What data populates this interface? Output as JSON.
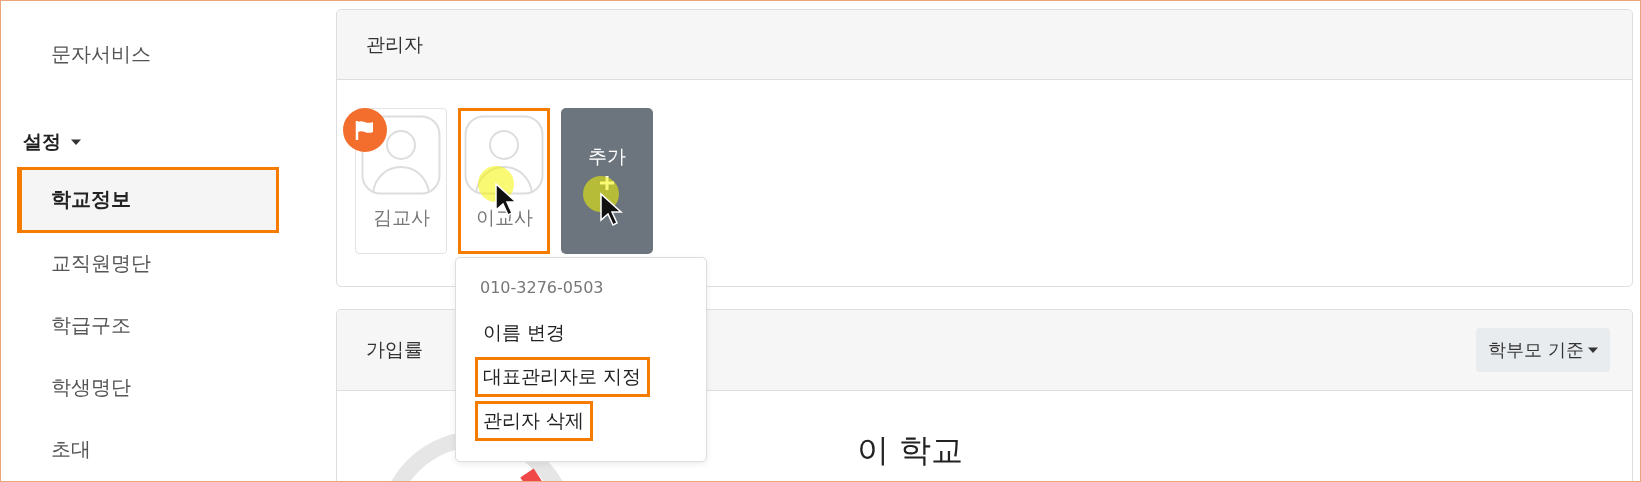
{
  "sidebar": {
    "items": [
      {
        "label": "문자서비스",
        "selected": false,
        "highlighted": false
      }
    ],
    "section": {
      "label": "설정",
      "expanded": true
    },
    "section_items": [
      {
        "label": "학교정보",
        "selected": true,
        "highlighted": true
      },
      {
        "label": "교직원명단",
        "selected": false,
        "highlighted": false
      },
      {
        "label": "학급구조",
        "selected": false,
        "highlighted": false
      },
      {
        "label": "학생명단",
        "selected": false,
        "highlighted": false
      },
      {
        "label": "초대",
        "selected": false,
        "highlighted": false
      }
    ]
  },
  "admin_card": {
    "title": "관리자",
    "admins": [
      {
        "name": "김교사",
        "representative": true,
        "highlighted": false,
        "pointer": false
      },
      {
        "name": "이교사",
        "representative": false,
        "highlighted": true,
        "pointer": true
      }
    ],
    "add_button": {
      "label": "추가",
      "pointer": true
    },
    "menu": {
      "phone": "010-3276-0503",
      "items": [
        {
          "label": "이름 변경",
          "highlighted": false
        },
        {
          "label": "대표관리자로 지정",
          "highlighted": true
        },
        {
          "label": "관리자 삭제",
          "highlighted": true
        }
      ]
    }
  },
  "rate_card": {
    "title": "가입률",
    "filter": "학부모 기준",
    "school_name": "이 학교"
  }
}
